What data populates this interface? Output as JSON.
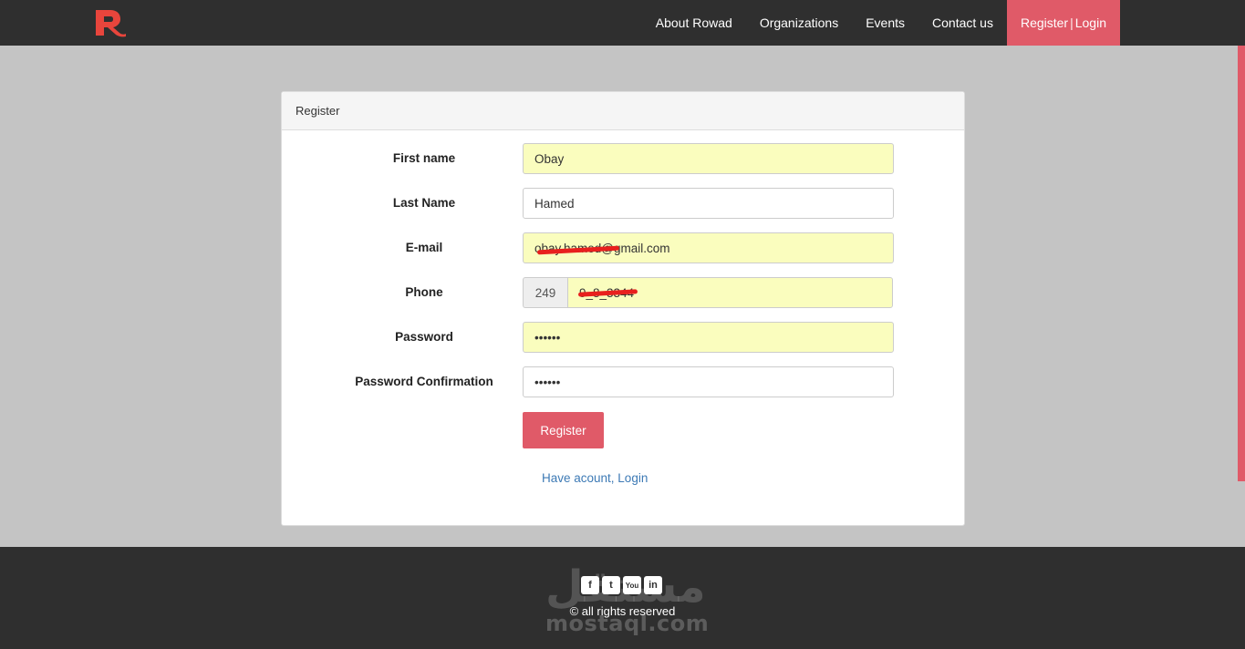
{
  "nav": {
    "logo_letter": "R",
    "links": [
      {
        "label": "About Rowad"
      },
      {
        "label": "Organizations"
      },
      {
        "label": "Events"
      },
      {
        "label": "Contact us"
      }
    ],
    "cta_register": "Register",
    "cta_separator": "|",
    "cta_login": "Login"
  },
  "panel": {
    "heading": "Register"
  },
  "form": {
    "first_name": {
      "label": "First name",
      "value": "Obay"
    },
    "last_name": {
      "label": "Last Name",
      "value": "Hamed"
    },
    "email": {
      "label": "E-mail",
      "value": "obay.hamed@gmail.com"
    },
    "phone": {
      "label": "Phone",
      "prefix": "249",
      "value": "9_8_3344"
    },
    "password": {
      "label": "Password",
      "value": "••••••"
    },
    "password_confirmation": {
      "label": "Password Confirmation",
      "value": "••••••"
    },
    "submit_label": "Register",
    "login_link": "Have acount, Login"
  },
  "footer": {
    "social": [
      {
        "icon": "facebook-icon",
        "glyph": "f"
      },
      {
        "icon": "twitter-icon",
        "glyph": "t"
      },
      {
        "icon": "youtube-icon",
        "glyph": "You"
      },
      {
        "icon": "linkedin-icon",
        "glyph": "in"
      }
    ],
    "copyright": "© all rights reserved",
    "watermark_ar": "مستقل",
    "watermark_en": "mostaql.com"
  },
  "colors": {
    "brand": "#e05a68",
    "nav_bg": "#2f2f2f",
    "page_bg": "#c4c4c4",
    "autofill_bg": "#fafdbe",
    "link": "#3d7ab5"
  }
}
